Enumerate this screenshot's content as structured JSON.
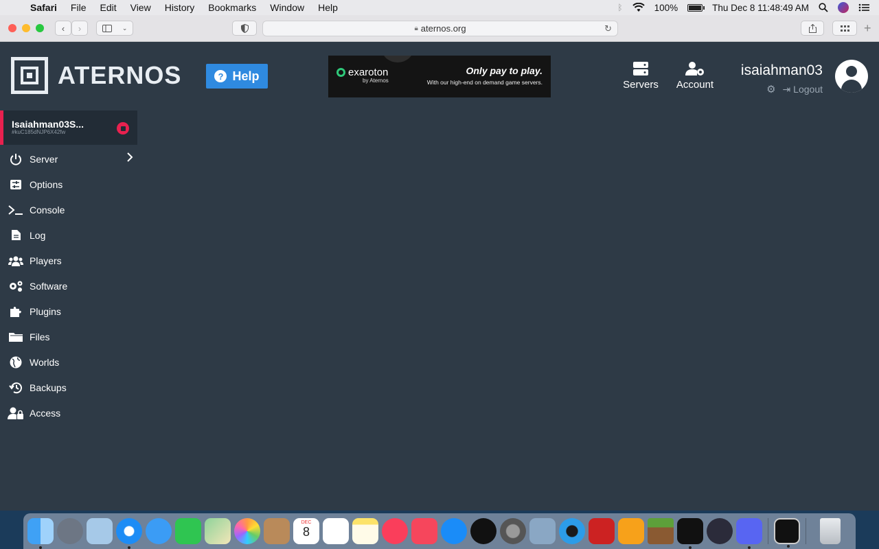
{
  "menubar": {
    "app": "Safari",
    "items": [
      "File",
      "Edit",
      "View",
      "History",
      "Bookmarks",
      "Window",
      "Help"
    ],
    "battery": "100%",
    "battery_level": 1.0,
    "datetime": "Thu Dec 8  11:48:49 AM"
  },
  "browser": {
    "url": "aternos.org"
  },
  "site": {
    "logo_text": "ATERNOS",
    "help_label": "Help",
    "ad": {
      "brand": "exaroton",
      "by": "by Aternos",
      "headline": "Only pay to play.",
      "sub": "With our high-end on demand game servers."
    },
    "nav": {
      "servers": "Servers",
      "account": "Account"
    },
    "user": {
      "name": "isaiahman03",
      "logout": "Logout"
    }
  },
  "server": {
    "name": "Isaiahman03S...",
    "id": "#kuC185dNJP6X42fw"
  },
  "sidebar": {
    "items": [
      {
        "label": "Server"
      },
      {
        "label": "Options"
      },
      {
        "label": "Console"
      },
      {
        "label": "Log"
      },
      {
        "label": "Players"
      },
      {
        "label": "Software"
      },
      {
        "label": "Plugins"
      },
      {
        "label": "Files"
      },
      {
        "label": "Worlds"
      },
      {
        "label": "Backups"
      },
      {
        "label": "Access"
      }
    ]
  },
  "dock": {
    "calendar_month": "DEC",
    "calendar_day": "8"
  },
  "colors": {
    "page_bg": "#2e3a46",
    "accent_red": "#e8214f",
    "help_blue": "#2f8ae0"
  }
}
